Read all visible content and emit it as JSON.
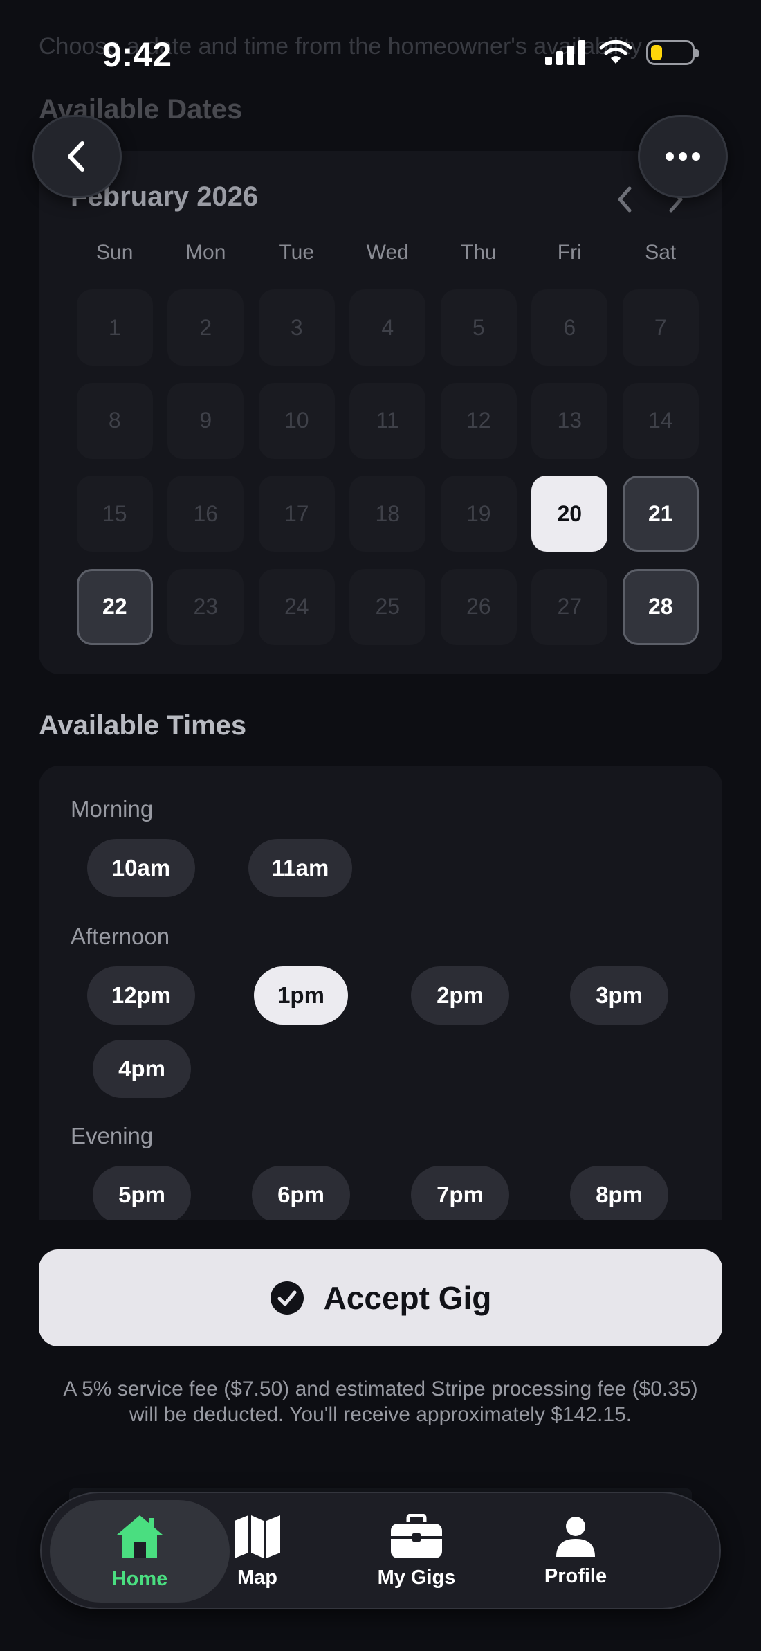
{
  "status_bar": {
    "time": "9:42"
  },
  "behind_text": "Choose a date and time from the homeowner's availability",
  "available_dates_title": "Available Dates",
  "calendar": {
    "month_label": "February 2026",
    "weekdays": [
      "Sun",
      "Mon",
      "Tue",
      "Wed",
      "Thu",
      "Fri",
      "Sat"
    ],
    "days": [
      {
        "d": "1",
        "state": "disabled"
      },
      {
        "d": "2",
        "state": "disabled"
      },
      {
        "d": "3",
        "state": "disabled"
      },
      {
        "d": "4",
        "state": "disabled"
      },
      {
        "d": "5",
        "state": "disabled"
      },
      {
        "d": "6",
        "state": "disabled"
      },
      {
        "d": "7",
        "state": "disabled"
      },
      {
        "d": "8",
        "state": "disabled"
      },
      {
        "d": "9",
        "state": "disabled"
      },
      {
        "d": "10",
        "state": "disabled"
      },
      {
        "d": "11",
        "state": "disabled"
      },
      {
        "d": "12",
        "state": "disabled"
      },
      {
        "d": "13",
        "state": "disabled"
      },
      {
        "d": "14",
        "state": "disabled"
      },
      {
        "d": "15",
        "state": "disabled"
      },
      {
        "d": "16",
        "state": "disabled"
      },
      {
        "d": "17",
        "state": "disabled"
      },
      {
        "d": "18",
        "state": "disabled"
      },
      {
        "d": "19",
        "state": "disabled"
      },
      {
        "d": "20",
        "state": "selected"
      },
      {
        "d": "21",
        "state": "available"
      },
      {
        "d": "22",
        "state": "available"
      },
      {
        "d": "23",
        "state": "disabled"
      },
      {
        "d": "24",
        "state": "disabled"
      },
      {
        "d": "25",
        "state": "disabled"
      },
      {
        "d": "26",
        "state": "disabled"
      },
      {
        "d": "27",
        "state": "disabled"
      },
      {
        "d": "28",
        "state": "available"
      }
    ]
  },
  "available_times_title": "Available Times",
  "times": {
    "morning_label": "Morning",
    "morning": [
      "10am",
      "11am"
    ],
    "afternoon_label": "Afternoon",
    "afternoon": [
      "12pm",
      "1pm",
      "2pm",
      "3pm",
      "4pm"
    ],
    "evening_label": "Evening",
    "evening": [
      "5pm",
      "6pm",
      "7pm",
      "8pm"
    ],
    "selected": "1pm"
  },
  "accept_button_label": "Accept Gig",
  "fee_note": "A 5% service fee ($7.50) and estimated Stripe processing fee ($0.35) will be deducted. You'll receive approximately $142.15.",
  "tabbar": {
    "home": "Home",
    "map": "Map",
    "gigs": "My Gigs",
    "profile": "Profile"
  },
  "colors": {
    "accent_green": "#4ade80",
    "selected_fill": "#ecebf0",
    "battery": "#ffd60a"
  }
}
